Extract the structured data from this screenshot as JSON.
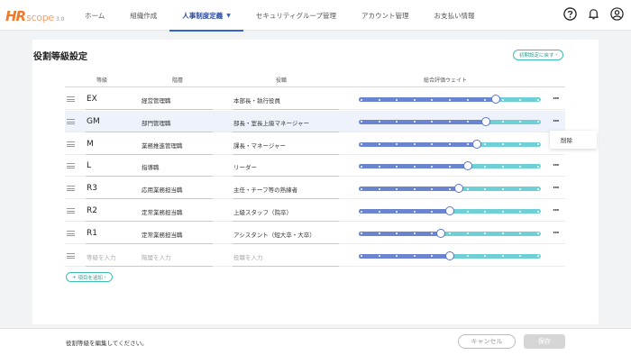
{
  "app": {
    "logo_main": "HR",
    "logo_sub": "scope",
    "logo_version": "3.0"
  },
  "nav": {
    "items": [
      {
        "label": "ホーム"
      },
      {
        "label": "組織作成"
      },
      {
        "label": "人事制度定義",
        "active": true
      },
      {
        "label": "セキュリティグループ管理"
      },
      {
        "label": "アカウント管理"
      },
      {
        "label": "お支払い情報"
      }
    ],
    "icons": [
      "help-circle-icon",
      "bell-icon",
      "user-circle-icon"
    ]
  },
  "page": {
    "title": "役割等級設定",
    "reset_label": "初期設定に戻す",
    "columns": {
      "grade": "等級",
      "tier": "階層",
      "role": "役職",
      "weight": "総合評価ウェイト"
    },
    "rows": [
      {
        "grade": "EX",
        "tier": "経営管理職",
        "role": "本部長・執行役員",
        "weight": 0.75
      },
      {
        "grade": "GM",
        "tier": "部門管理職",
        "role": "部長・室長上級マネージャー",
        "weight": 0.7,
        "selected": true
      },
      {
        "grade": "M",
        "tier": "業務推進管理職",
        "role": "課長・マネージャー",
        "weight": 0.65
      },
      {
        "grade": "L",
        "tier": "指導職",
        "role": "リーダー",
        "weight": 0.6
      },
      {
        "grade": "R3",
        "tier": "応用業務担当職",
        "role": "主任・チーフ等の熟練者",
        "weight": 0.55
      },
      {
        "grade": "R2",
        "tier": "定常業務担当職",
        "role": "上級スタッフ（院卒）",
        "weight": 0.5
      },
      {
        "grade": "R1",
        "tier": "定常業務担当職",
        "role": "アシスタント（短大卒・大卒）",
        "weight": 0.45
      },
      {
        "grade": "",
        "tier": "",
        "role": "",
        "weight": 0.5,
        "placeholder": true
      }
    ],
    "placeholders": {
      "grade": "等級を入力",
      "tier": "階層を入力",
      "role": "役職を入力"
    },
    "context_menu": {
      "delete_label": "削除"
    },
    "add_label": "項目を追加"
  },
  "footer": {
    "message": "役割等級を編集してください。",
    "cancel_label": "キャンセル",
    "save_label": "保存"
  },
  "colors": {
    "accent": "#3563c7",
    "teal": "#3bbfb2",
    "slider_fill": "#6b84cf",
    "slider_track": "#6fcfd6",
    "logo": "#f07a2c"
  }
}
